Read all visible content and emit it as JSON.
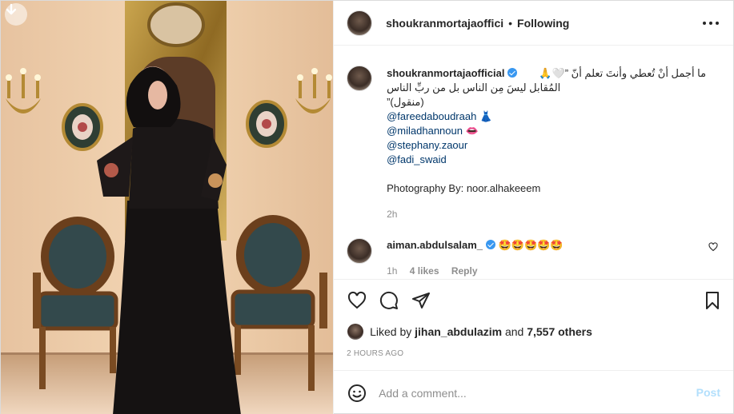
{
  "post": {
    "header": {
      "username": "shoukranmortajaofficial",
      "username_display": "shoukranmortajaoffici",
      "separator": "•",
      "follow_label": "Following"
    },
    "caption": {
      "username": "shoukranmortajaofficial",
      "line1": "ما أجمل أنْ تُعطي وأنتَ تعلم أنّ ”🤍🙏",
      "line2": "المُقابل ليسَ مِن الناس بل من ربِّ الناس",
      "line3": "(منقول)”",
      "mentions": [
        {
          "handle": "@fareedaboudraah",
          "emoji": "👗"
        },
        {
          "handle": "@miladhannoun",
          "emoji": "👄"
        },
        {
          "handle": "@stephany.zaour",
          "emoji": ""
        },
        {
          "handle": "@fadi_swaid",
          "emoji": ""
        }
      ],
      "credit": "Photography By: noor.alhakeeem",
      "time": "2h"
    },
    "comment": {
      "username": "aiman.abdulsalam_",
      "text": "🤩🤩🤩🤩🤩",
      "time": "1h",
      "likes": "4 likes",
      "reply": "Reply"
    },
    "likes": {
      "prefix": "Liked by",
      "user": "jihan_abdulazim",
      "conj": "and",
      "others": "7,557 others"
    },
    "timestamp": "2 HOURS AGO",
    "add_comment": {
      "placeholder": "Add a comment...",
      "post_label": "Post"
    }
  },
  "icons": {
    "download": "download-arrow-icon",
    "more": "more-options-icon",
    "like": "heart-icon",
    "comment": "comment-bubble-icon",
    "share": "paper-plane-icon",
    "save": "bookmark-icon",
    "emoji": "smiley-icon",
    "comment_like": "small-heart-icon"
  },
  "colors": {
    "link": "#00376b",
    "verified": "#3897f0",
    "muted": "#8e8e8e",
    "post_disabled": "#b2dffc"
  }
}
